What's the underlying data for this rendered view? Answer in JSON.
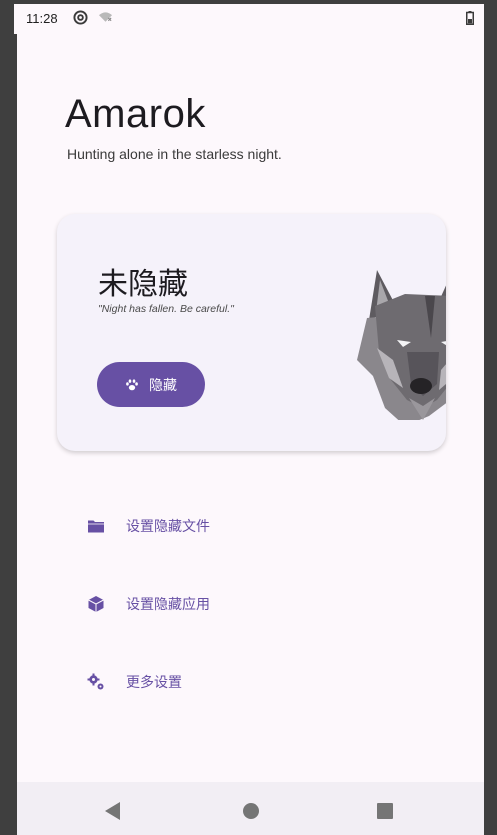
{
  "status_bar": {
    "time": "11:28",
    "icons": [
      "at-sign-icon",
      "wifi-off-icon",
      "battery-icon"
    ]
  },
  "app": {
    "title": "Amarok",
    "subtitle": "Hunting alone in the starless night."
  },
  "status_card": {
    "status_text": "未隐藏",
    "quote": "\"Night has fallen. Be careful.\"",
    "button_label": "隐藏",
    "button_icon": "paw-icon",
    "art_icon": "wolf-icon"
  },
  "menu": [
    {
      "label": "设置隐藏文件",
      "icon": "folder-icon"
    },
    {
      "label": "设置隐藏应用",
      "icon": "package-icon"
    },
    {
      "label": "更多设置",
      "icon": "gears-icon"
    }
  ],
  "navbar": {
    "buttons": [
      "back",
      "home",
      "recents"
    ]
  },
  "colors": {
    "accent": "#6750a4",
    "background": "#fdf8fc",
    "card": "#f5f2fa",
    "navbar": "#f2eef4"
  }
}
